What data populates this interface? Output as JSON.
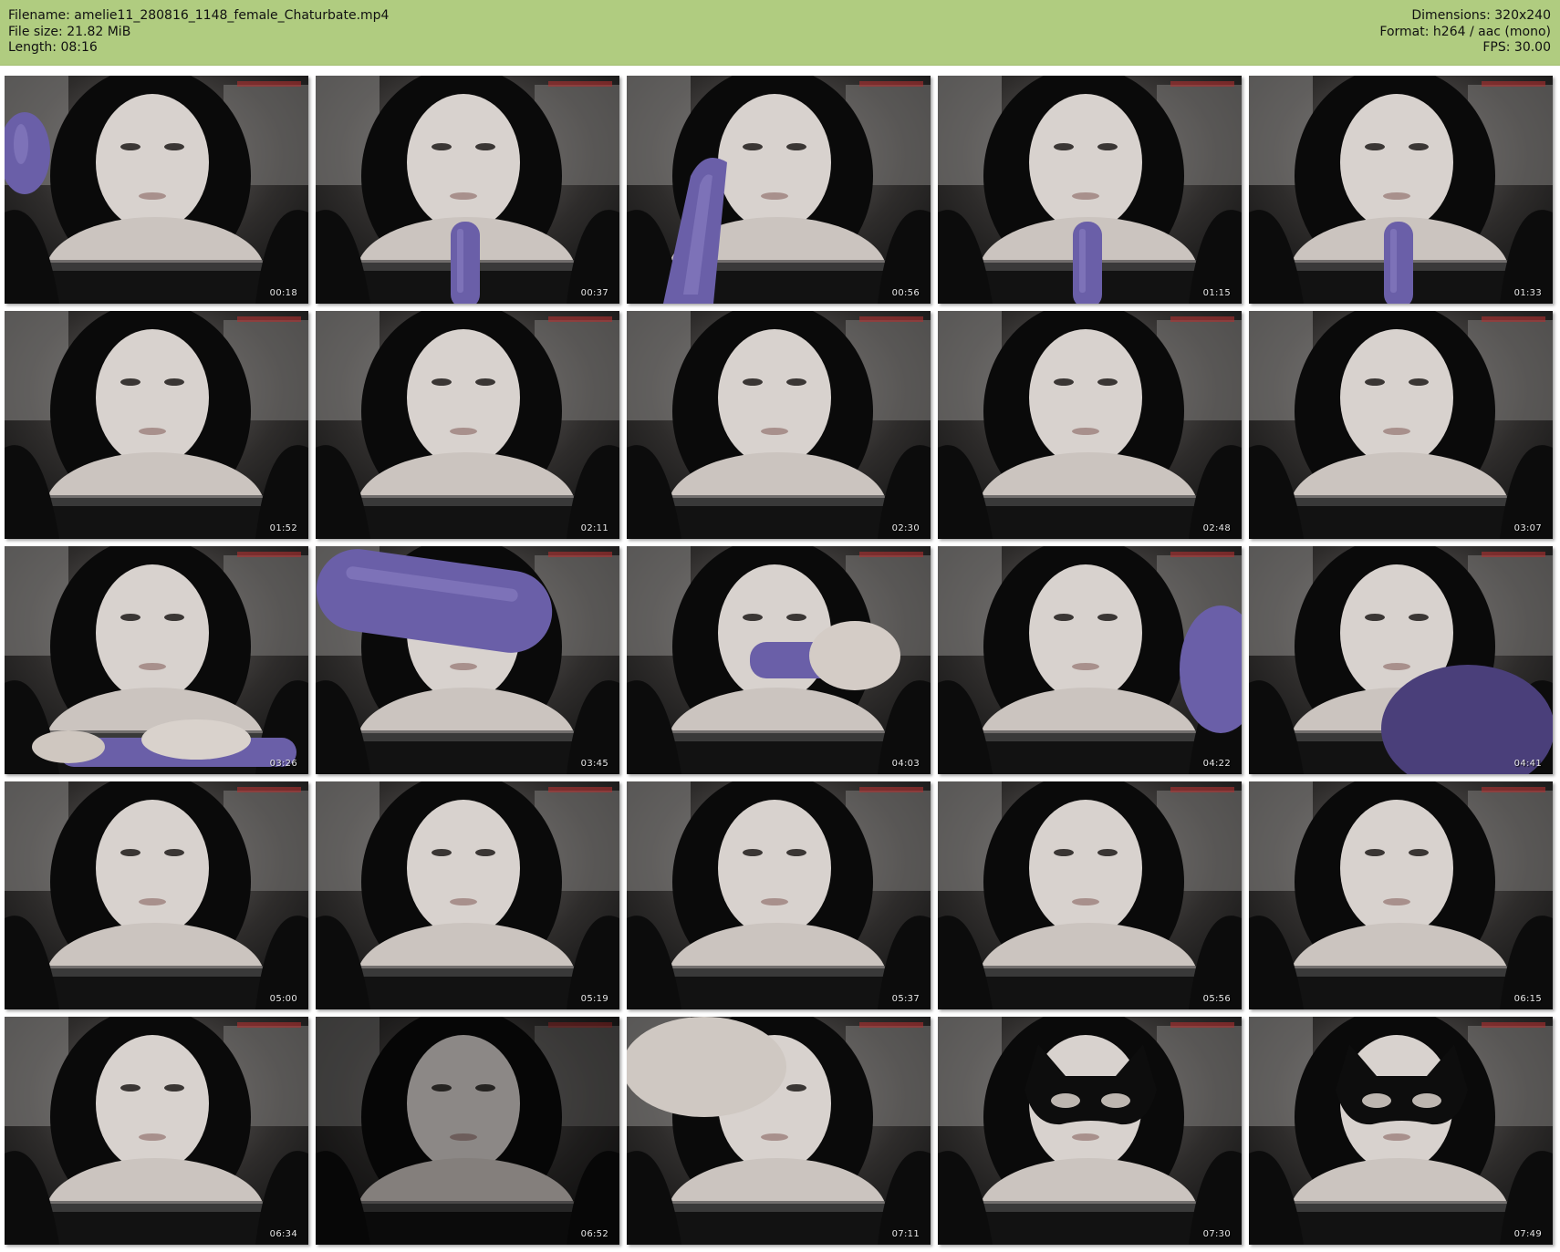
{
  "header": {
    "filename": "Filename: amelie11_280816_1148_female_Chaturbate.mp4",
    "file_size": "File size: 21.82 MiB",
    "length": "Length: 08:16",
    "dimensions": "Dimensions: 320x240",
    "format": "Format: h264 / aac (mono)",
    "fps": "FPS: 30.00"
  },
  "colors": {
    "header_bg": "#b0cc80",
    "page_bg": "#ffffff",
    "timestamp_text": "#e8e8e8"
  },
  "thumbnails": [
    {
      "timestamp": "00:18",
      "prop": "toy-left"
    },
    {
      "timestamp": "00:37",
      "prop": "toy-center"
    },
    {
      "timestamp": "00:56",
      "prop": "toy-large-left"
    },
    {
      "timestamp": "01:15",
      "prop": "toy-center"
    },
    {
      "timestamp": "01:33",
      "prop": "toy-center"
    },
    {
      "timestamp": "01:52",
      "prop": "none"
    },
    {
      "timestamp": "02:11",
      "prop": "none"
    },
    {
      "timestamp": "02:30",
      "prop": "none"
    },
    {
      "timestamp": "02:48",
      "prop": "none"
    },
    {
      "timestamp": "03:07",
      "prop": "none"
    },
    {
      "timestamp": "03:26",
      "prop": "toy-bottom"
    },
    {
      "timestamp": "03:45",
      "prop": "toy-top"
    },
    {
      "timestamp": "04:03",
      "prop": "toy-hand"
    },
    {
      "timestamp": "04:22",
      "prop": "toy-right"
    },
    {
      "timestamp": "04:41",
      "prop": "toy-right-low"
    },
    {
      "timestamp": "05:00",
      "prop": "none"
    },
    {
      "timestamp": "05:19",
      "prop": "none"
    },
    {
      "timestamp": "05:37",
      "prop": "none"
    },
    {
      "timestamp": "05:56",
      "prop": "none"
    },
    {
      "timestamp": "06:15",
      "prop": "none"
    },
    {
      "timestamp": "06:34",
      "prop": "none"
    },
    {
      "timestamp": "06:52",
      "prop": "head-down"
    },
    {
      "timestamp": "07:11",
      "prop": "hand-face"
    },
    {
      "timestamp": "07:30",
      "prop": "mask"
    },
    {
      "timestamp": "07:49",
      "prop": "mask"
    }
  ]
}
